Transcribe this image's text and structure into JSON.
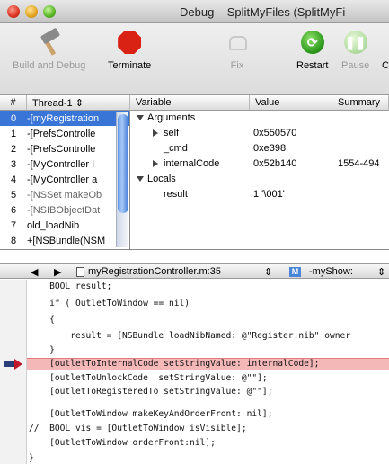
{
  "window": {
    "title": "Debug – SplitMyFiles (SplitMyFi"
  },
  "toolbar": {
    "build_and_debug": "Build and Debug",
    "terminate": "Terminate",
    "fix": "Fix",
    "restart": "Restart",
    "pause": "Pause",
    "continue_partial": "C"
  },
  "stack": {
    "col_num": "#",
    "col_thread": "Thread-1",
    "frames": [
      {
        "num": "0",
        "name": "-[myRegistration"
      },
      {
        "num": "1",
        "name": "-[PrefsControlle"
      },
      {
        "num": "2",
        "name": "-[PrefsControlle"
      },
      {
        "num": "3",
        "name": "-[MyController I"
      },
      {
        "num": "4",
        "name": "-[MyController a"
      },
      {
        "num": "5",
        "name": "-[NSSet makeOb"
      },
      {
        "num": "6",
        "name": "-[NSIBObjectDat"
      },
      {
        "num": "7",
        "name": "old_loadNib"
      },
      {
        "num": "8",
        "name": "+[NSBundle(NSM"
      }
    ]
  },
  "variables": {
    "col_variable": "Variable",
    "col_value": "Value",
    "col_summary": "Summary",
    "rows": [
      {
        "name": "Arguments",
        "value": "",
        "summary": ""
      },
      {
        "name": "self",
        "value": "0x550570",
        "summary": ""
      },
      {
        "name": "_cmd",
        "value": "0xe398",
        "summary": ""
      },
      {
        "name": "internalCode",
        "value": "0x52b140",
        "summary": "1554-494"
      },
      {
        "name": "Locals",
        "value": "",
        "summary": ""
      },
      {
        "name": "result",
        "value": "1 '\\001'",
        "summary": ""
      }
    ]
  },
  "navigator": {
    "back": "◀",
    "forward": "▶",
    "file": "myRegistrationController.m:35",
    "method": "-myShow:"
  },
  "code": {
    "lines": [
      "    BOOL result;",
      "    if ( OutletToWindow == nil)",
      "    {",
      "        result = [NSBundle loadNibNamed: @\"Register.nib\" owner",
      "    }",
      "    [outletToInternalCode setStringValue: internalCode];",
      "    [outletToUnlockCode  setStringValue: @\"\"];",
      "    [outletToRegisteredTo setStringValue: @\"\"];",
      "",
      "    [OutletToWindow makeKeyAndOrderFront: nil];",
      "//  BOOL vis = [OutletToWindow isVisible];",
      "    [OutletToWindow orderFront:nil];",
      "}"
    ]
  }
}
